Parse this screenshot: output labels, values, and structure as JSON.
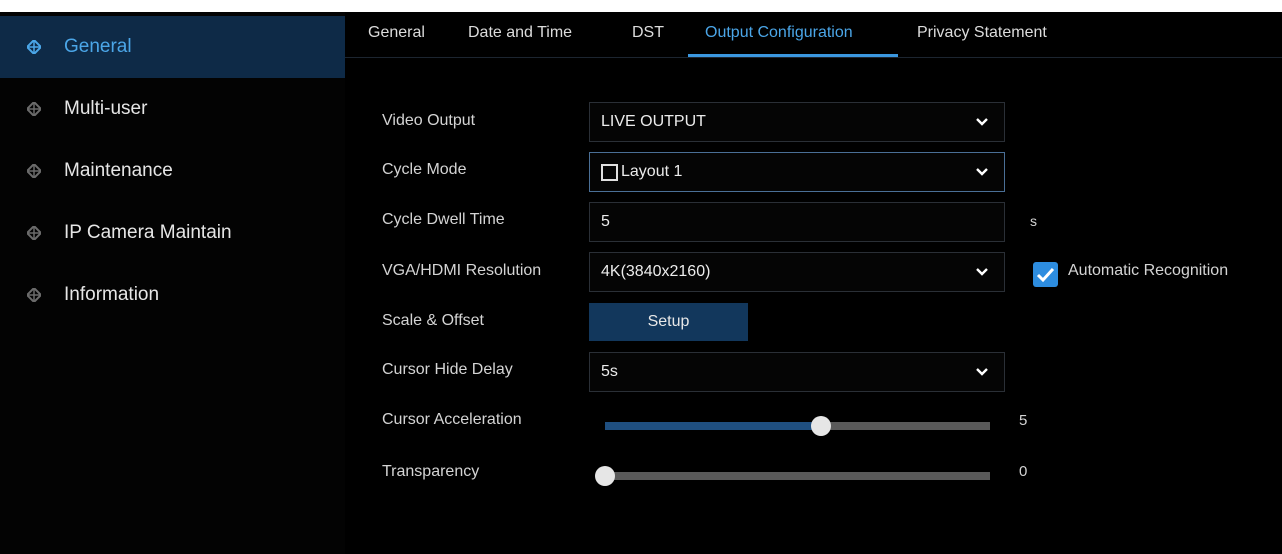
{
  "sidebar": {
    "items": [
      {
        "label": "General",
        "active": true
      },
      {
        "label": "Multi-user",
        "active": false
      },
      {
        "label": "Maintenance",
        "active": false
      },
      {
        "label": "IP Camera Maintain",
        "active": false
      },
      {
        "label": "Information",
        "active": false
      }
    ]
  },
  "tabs": [
    {
      "label": "General"
    },
    {
      "label": "Date and Time"
    },
    {
      "label": "DST"
    },
    {
      "label": "Output Configuration",
      "active": true
    },
    {
      "label": "Privacy Statement"
    }
  ],
  "form": {
    "video_output": {
      "label": "Video Output",
      "value": "LIVE OUTPUT"
    },
    "cycle_mode": {
      "label": "Cycle Mode",
      "value": "Layout 1"
    },
    "cycle_dwell": {
      "label": "Cycle Dwell Time",
      "value": "5",
      "unit": "s"
    },
    "resolution": {
      "label": "VGA/HDMI Resolution",
      "value": "4K(3840x2160)",
      "auto_label": "Automatic Recognition",
      "auto_checked": true
    },
    "scale_offset": {
      "label": "Scale & Offset",
      "button": "Setup"
    },
    "cursor_hide": {
      "label": "Cursor Hide Delay",
      "value": "5s"
    },
    "cursor_accel": {
      "label": "Cursor Acceleration",
      "value": "5",
      "fraction": 0.56
    },
    "transparency": {
      "label": "Transparency",
      "value": "0",
      "fraction": 0
    }
  },
  "colors": {
    "accent": "#4ba6e8",
    "active_bg": "#0e2a47",
    "button_bg": "#12375c",
    "checkbox": "#2d8de0"
  }
}
